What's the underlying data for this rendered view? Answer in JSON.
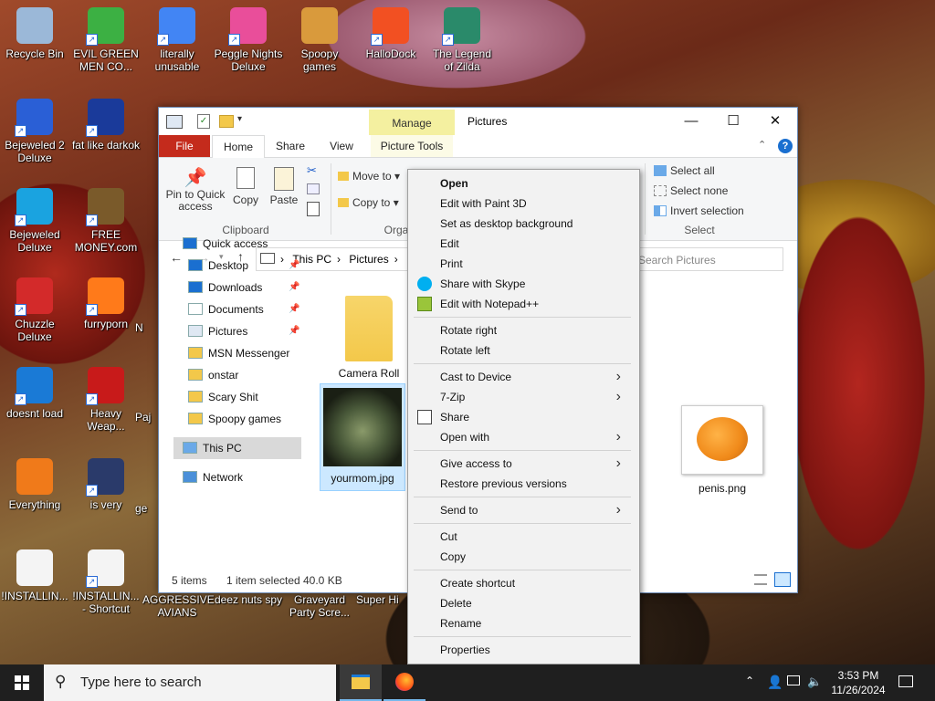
{
  "desktop_icons": [
    {
      "label": "Recycle Bin",
      "color": "#9bb8d8",
      "shortcut": false
    },
    {
      "label": "EVIL GREEN MEN CO...",
      "color": "#3cb043",
      "shortcut": true
    },
    {
      "label": "literally unusable",
      "color": "#4285f4",
      "shortcut": true
    },
    {
      "label": "Peggle Nights Deluxe",
      "color": "#e94e9a",
      "shortcut": true
    },
    {
      "label": "Spoopy games",
      "color": "#d99a3c",
      "shortcut": false
    },
    {
      "label": "HalloDock",
      "color": "#f25022",
      "shortcut": true
    },
    {
      "label": "The Legend of Zilda",
      "color": "#2a8a6a",
      "shortcut": true
    },
    {
      "label": "Bejeweled 2 Deluxe",
      "color": "#2a5fd6",
      "shortcut": true
    },
    {
      "label": "fat like darkok",
      "color": "#1a3a9a",
      "shortcut": true
    },
    {
      "label": "Bejeweled Deluxe",
      "color": "#1aa3e0",
      "shortcut": true
    },
    {
      "label": "FREE MONEY.com",
      "color": "#7a5a2a",
      "shortcut": true
    },
    {
      "label": "Chuzzle Deluxe",
      "color": "#d32a2a",
      "shortcut": true
    },
    {
      "label": "furryporn",
      "color": "#ff7a1a",
      "shortcut": true
    },
    {
      "label": "doesnt load",
      "color": "#1a7ad6",
      "shortcut": true
    },
    {
      "label": "Heavy Weap...",
      "color": "#c81a1a",
      "shortcut": true
    },
    {
      "label": "Everything",
      "color": "#f07a1a",
      "shortcut": false
    },
    {
      "label": "is very",
      "color": "#2a3a6a",
      "shortcut": true
    },
    {
      "label": "!INSTALLIN...",
      "color": "#f4f4f4",
      "shortcut": false
    },
    {
      "label": "!INSTALLIN... - Shortcut",
      "color": "#f4f4f4",
      "shortcut": true
    },
    {
      "label": "AGGRESSIVE AVIANS",
      "color": "",
      "shortcut": false
    },
    {
      "label": "deez nuts spy",
      "color": "",
      "shortcut": false
    },
    {
      "label": "Graveyard Party Scre...",
      "color": "",
      "shortcut": false
    },
    {
      "label": "Super Hi",
      "color": "",
      "shortcut": false
    },
    {
      "label": "N",
      "color": "",
      "shortcut": false
    },
    {
      "label": "Paj",
      "color": "",
      "shortcut": false
    },
    {
      "label": "ge",
      "color": "",
      "shortcut": false
    }
  ],
  "explorer": {
    "title": "Pictures",
    "manage_label": "Manage",
    "tabs": [
      "File",
      "Home",
      "Share",
      "View",
      "Picture Tools"
    ],
    "ribbon": {
      "pin": "Pin to Quick access",
      "copy": "Copy",
      "paste": "Paste",
      "clipboard_group": "Clipboard",
      "move_to": "Move to",
      "copy_to": "Copy to",
      "organize_group": "Orga",
      "select_all": "Select all",
      "select_none": "Select none",
      "invert_selection": "Invert selection",
      "select_group": "Select"
    },
    "address": {
      "segments": [
        "This PC",
        "Pictures"
      ],
      "search_placeholder": "Search Pictures"
    },
    "nav": [
      {
        "label": "Quick access",
        "icon": "star-icon",
        "pinned": false,
        "indent": 0
      },
      {
        "label": "Desktop",
        "icon": "desktop-icon",
        "pinned": true,
        "indent": 1
      },
      {
        "label": "Downloads",
        "icon": "download-icon",
        "pinned": true,
        "indent": 1
      },
      {
        "label": "Documents",
        "icon": "document-icon",
        "pinned": true,
        "indent": 1
      },
      {
        "label": "Pictures",
        "icon": "pictures-icon",
        "pinned": true,
        "indent": 1
      },
      {
        "label": "MSN Messenger",
        "icon": "folder-icon",
        "pinned": false,
        "indent": 1
      },
      {
        "label": "onstar",
        "icon": "folder-icon",
        "pinned": false,
        "indent": 1
      },
      {
        "label": "Scary Shit",
        "icon": "folder-icon",
        "pinned": false,
        "indent": 1
      },
      {
        "label": "Spoopy games",
        "icon": "folder-icon",
        "pinned": false,
        "indent": 1
      },
      {
        "label": "This PC",
        "icon": "computer-icon",
        "pinned": false,
        "indent": 0,
        "selected": true
      },
      {
        "label": "Network",
        "icon": "network-icon",
        "pinned": false,
        "indent": 0
      }
    ],
    "files": [
      {
        "label": "Camera Roll",
        "kind": "folder"
      },
      {
        "label": "yourmom.jpg",
        "kind": "image-dark",
        "selected": true
      },
      {
        "label": "penis.png",
        "kind": "image-pumpkin"
      }
    ],
    "status": {
      "items": "5 items",
      "selected": "1 item selected",
      "size": "40.0 KB"
    }
  },
  "context_menu": [
    {
      "label": "Open",
      "bold": true
    },
    {
      "label": "Edit with Paint 3D"
    },
    {
      "label": "Set as desktop background"
    },
    {
      "label": "Edit"
    },
    {
      "label": "Print"
    },
    {
      "label": "Share with Skype",
      "icon": "skype-icon"
    },
    {
      "label": "Edit with Notepad++",
      "icon": "notepad-icon"
    },
    {
      "sep": true
    },
    {
      "label": "Rotate right"
    },
    {
      "label": "Rotate left"
    },
    {
      "sep": true
    },
    {
      "label": "Cast to Device",
      "submenu": true
    },
    {
      "label": "7-Zip",
      "submenu": true
    },
    {
      "label": "Share",
      "icon": "share-icon"
    },
    {
      "label": "Open with",
      "submenu": true
    },
    {
      "sep": true
    },
    {
      "label": "Give access to",
      "submenu": true
    },
    {
      "label": "Restore previous versions"
    },
    {
      "sep": true
    },
    {
      "label": "Send to",
      "submenu": true
    },
    {
      "sep": true
    },
    {
      "label": "Cut"
    },
    {
      "label": "Copy"
    },
    {
      "sep": true
    },
    {
      "label": "Create shortcut"
    },
    {
      "label": "Delete"
    },
    {
      "label": "Rename"
    },
    {
      "sep": true
    },
    {
      "label": "Properties"
    }
  ],
  "taskbar": {
    "search_placeholder": "Type here to search",
    "time": "3:53 PM",
    "date": "11/26/2024"
  },
  "colors": {
    "accent": "#0078d7",
    "file_tab": "#c42b1c",
    "manage_tab": "#f4f0a0",
    "selection": "#cce8ff"
  }
}
